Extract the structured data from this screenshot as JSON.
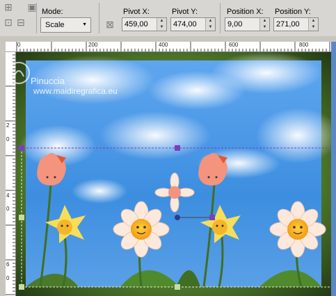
{
  "toolbar": {
    "mode_label": "Mode:",
    "mode_value": "Scale",
    "pivot_x_label": "Pivot X:",
    "pivot_x_value": "459,00",
    "pivot_y_label": "Pivot Y:",
    "pivot_y_value": "474,00",
    "position_x_label": "Position X:",
    "position_x_value": "9,00",
    "position_y_label": "Position Y:",
    "position_y_value": "271,00"
  },
  "ruler": {
    "top_ticks": [
      "0",
      "200",
      "400",
      "600",
      "800"
    ],
    "left_ticks": [
      "2",
      "0",
      "4",
      "0",
      "6",
      "0"
    ]
  },
  "watermark": {
    "name": "Pinuccia",
    "url": "www.maidiregrafica.eu"
  },
  "colors": {
    "toolbar_bg": "#d8d6d2",
    "canvas_frame": "#2d4a1e",
    "sky": "#3d8ee0",
    "guide_line": "#7a3fbf"
  }
}
